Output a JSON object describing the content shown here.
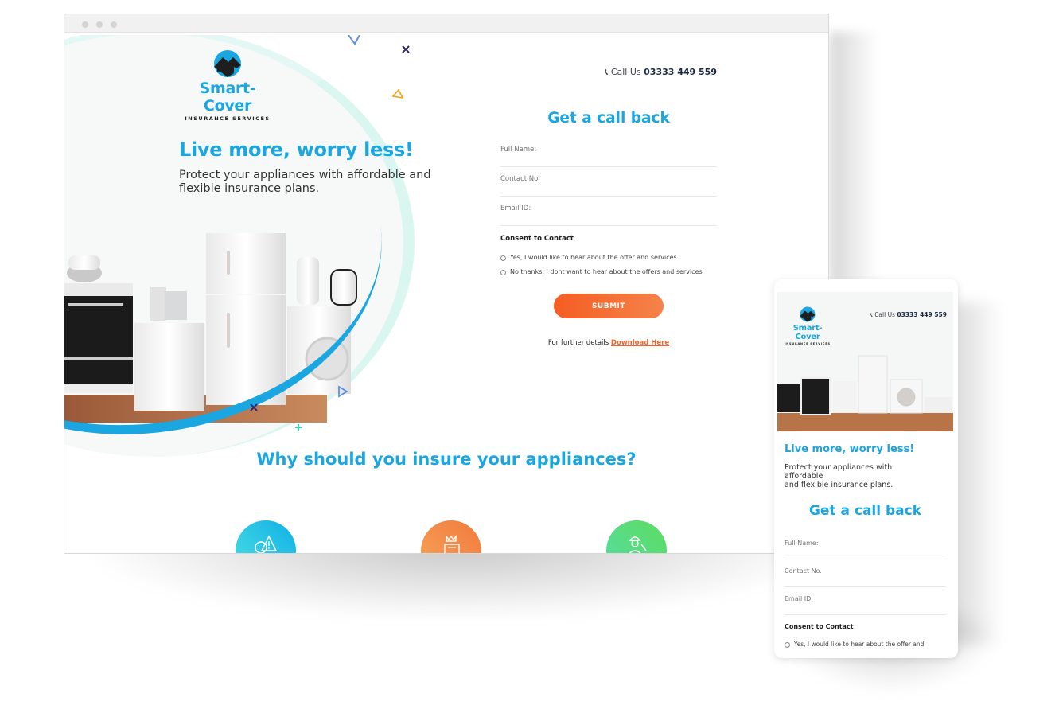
{
  "brand": {
    "name": "Smart-Cover",
    "tagline": "INSURANCE SERVICES",
    "primary_color": "#1aa6e0",
    "accent_color": "#f55d22"
  },
  "header": {
    "call_label": "Call Us",
    "phone": "03333 449 559"
  },
  "hero": {
    "title": "Live more, worry less!",
    "subtitle": "Protect your appliances with affordable and flexible insurance plans."
  },
  "form": {
    "title": "Get a call back",
    "fields": [
      {
        "placeholder": "Full Name:"
      },
      {
        "placeholder": "Contact No."
      },
      {
        "placeholder": "Email ID:"
      }
    ],
    "consent_title": "Consent to Contact",
    "options": [
      "Yes, I would like to hear about the offer and services",
      "No thanks, I dont want to hear about the offers and services"
    ],
    "submit_label": "SUBMIT",
    "further_text": "For further details",
    "download_link": "Download Here"
  },
  "why": {
    "title": "Why should you insure your appliances?",
    "features": [
      {
        "icon": "appliance-warning-icon",
        "color_start": "#4fe0e0",
        "color_end": "#10b0e8"
      },
      {
        "icon": "money-bag-icon",
        "color_start": "#f5a65c",
        "color_end": "#f27a3b"
      },
      {
        "icon": "technician-icon",
        "color_start": "#55dca8",
        "color_end": "#5ddc5e"
      }
    ]
  },
  "mobile": {
    "subtitle_line1": "Protect your appliances with affordable",
    "subtitle_line2": "and flexible insurance plans."
  }
}
